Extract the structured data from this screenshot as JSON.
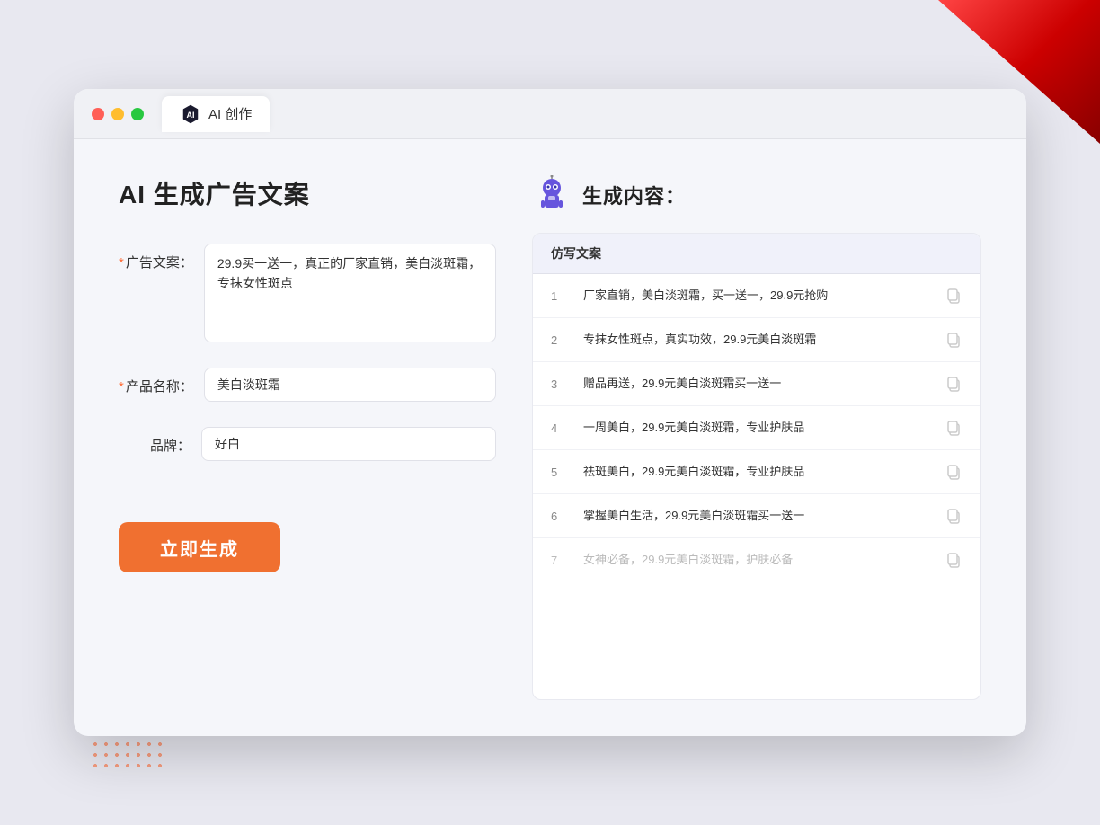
{
  "window": {
    "tab_label": "AI 创作"
  },
  "page": {
    "title": "AI 生成广告文案"
  },
  "form": {
    "ad_copy_label": "广告文案：",
    "ad_copy_required": "*",
    "ad_copy_value": "29.9买一送一，真正的厂家直销，美白淡斑霜，专抹女性斑点",
    "product_label": "产品名称：",
    "product_required": "*",
    "product_value": "美白淡斑霜",
    "brand_label": "品牌：",
    "brand_value": "好白",
    "generate_btn": "立即生成"
  },
  "result": {
    "title": "生成内容：",
    "table_header": "仿写文案",
    "rows": [
      {
        "id": 1,
        "text": "厂家直销，美白淡斑霜，买一送一，29.9元抢购",
        "muted": false
      },
      {
        "id": 2,
        "text": "专抹女性斑点，真实功效，29.9元美白淡斑霜",
        "muted": false
      },
      {
        "id": 3,
        "text": "赠品再送，29.9元美白淡斑霜买一送一",
        "muted": false
      },
      {
        "id": 4,
        "text": "一周美白，29.9元美白淡斑霜，专业护肤品",
        "muted": false
      },
      {
        "id": 5,
        "text": "祛斑美白，29.9元美白淡斑霜，专业护肤品",
        "muted": false
      },
      {
        "id": 6,
        "text": "掌握美白生活，29.9元美白淡斑霜买一送一",
        "muted": false
      },
      {
        "id": 7,
        "text": "女神必备，29.9元美白淡斑霜，护肤必备",
        "muted": true
      }
    ]
  }
}
